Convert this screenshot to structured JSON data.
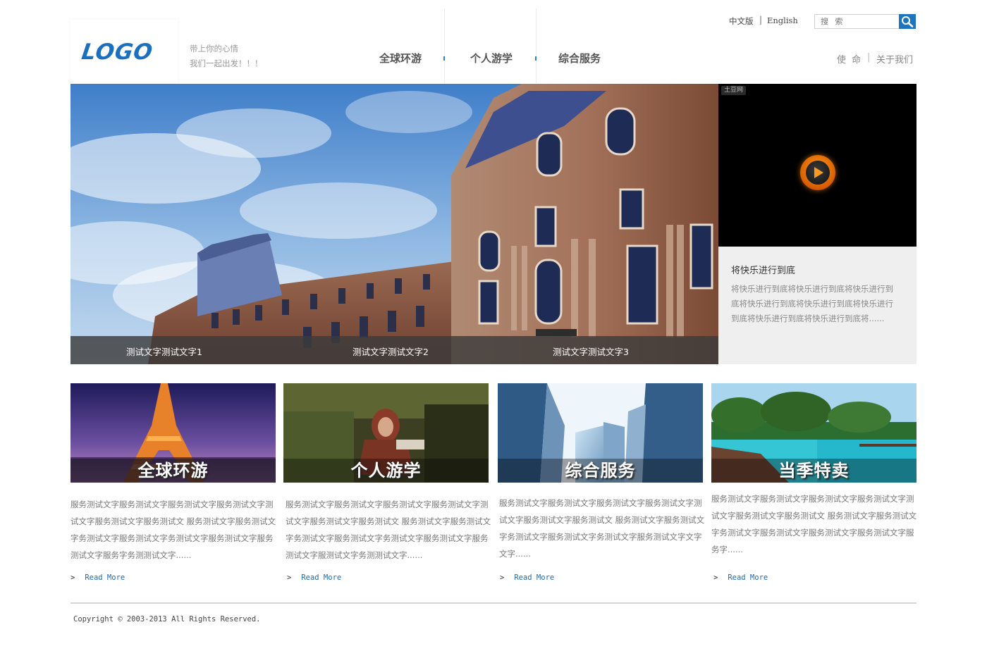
{
  "header": {
    "logo": "LOGO",
    "tagline_line1": "带上你的心情",
    "tagline_line2": "我们一起出发！！！",
    "nav": [
      "全球环游",
      "个人游学",
      "综合服务"
    ],
    "lang_zh": "中文版",
    "lang_sep": "|",
    "lang_en": "English",
    "search_placeholder": "搜 索",
    "right_links": [
      "使 命",
      "关于我们"
    ],
    "right_sep": "|"
  },
  "banner": {
    "captions": [
      "测试文字测试文字1",
      "测试文字测试文字2",
      "测试文字测试文字3"
    ]
  },
  "video": {
    "badge": "土豆网",
    "title": "将快乐进行到底",
    "description": "将快乐进行到底将快乐进行到底将快乐进行到底将快乐进行到底将快乐进行到底将快乐进行到底将快乐进行到底将快乐进行到底将......"
  },
  "cards": [
    {
      "label": "全球环游",
      "text": "服务测试文字服务测试文字服务测试文字服务测试文字测试文字服务测试文字服务测试文 服务测试文字服务测试文字务测试文字服务测试文字务测试文字服务测试文字服务测试文字服务字务测测试文字......",
      "read_more": "Read More",
      "arrow": ">"
    },
    {
      "label": "个人游学",
      "text": "服务测试文字服务测试文字服务测试文字服务测试文字测试文字服务测试文字服务测试文 服务测试文字服务测试文字务测试文字服务测试文字务测试文字服务测试文字服务测试文字服测试文字务测测试文字......",
      "read_more": "Read More",
      "arrow": ">"
    },
    {
      "label": "综合服务",
      "text": "服务测试文字服务测试文字服务测试文字服务测试文字测试文字服务测试文字服务测试文 服务测试文字服务测试文字务测试文字服务测试文字务测试文字服务测试文字文字文字......",
      "read_more": "Read More",
      "arrow": ">"
    },
    {
      "label": "当季特卖",
      "text": "服务测试文字服务测试文字服务测试文字服务测试文字测试文字服务测试文字服务测试文 服务测试文字服务测试文字务测试文字服务测试文字服务测试文字服务测试文字服务字......",
      "read_more": "Read More",
      "arrow": ">"
    }
  ],
  "footer": {
    "copyright": "Copyright © 2003-2013  All Rights Reserved."
  },
  "colors": {
    "brand_blue": "#1a6fc0",
    "link_blue": "#1f6bb0",
    "video_bg": "#000000",
    "video_info_bg": "#efefef"
  }
}
